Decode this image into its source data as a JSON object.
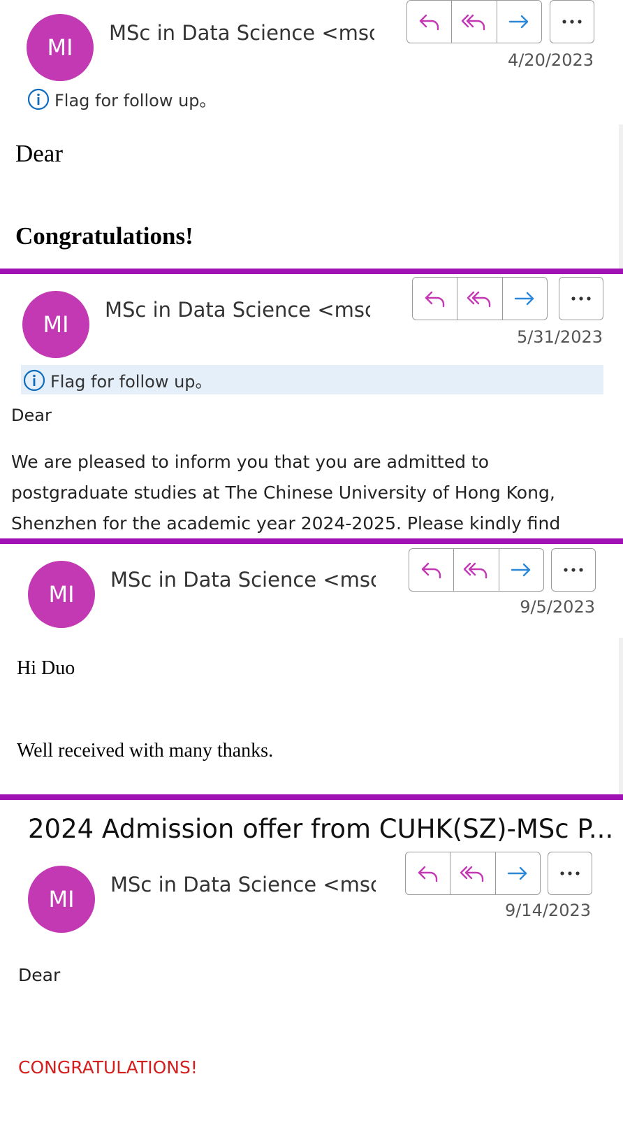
{
  "colors": {
    "accent": "#a012b4",
    "avatar": "#c239b3",
    "reply_icon": "#c239b3",
    "forward_icon": "#2b88d8",
    "flag_icon": "#0f6cbd",
    "alert_red": "#d41f1f"
  },
  "emails": [
    {
      "avatar_initials": "MI",
      "sender": "MSc in Data Science <msc",
      "date": "4/20/2023",
      "flag_text": "Flag for follow up。",
      "body": [
        "Dear",
        "Congratulations!"
      ]
    },
    {
      "avatar_initials": "MI",
      "sender": "MSc in Data Science <msc",
      "date": "5/31/2023",
      "flag_text": "Flag for follow up。",
      "body": [
        "Dear",
        "We are pleased to inform you that you are admitted to",
        "postgraduate studies at The Chinese University of Hong Kong,",
        "Shenzhen for the academic year 2024-2025. Please kindly find"
      ]
    },
    {
      "avatar_initials": "MI",
      "sender": "MSc in Data Science <msc",
      "date": "9/5/2023",
      "body": [
        "Hi Duo",
        "Well received with many thanks."
      ]
    },
    {
      "subject": "2024 Admission offer from CUHK(SZ)-MSc P...",
      "avatar_initials": "MI",
      "sender": "MSc in Data Science <msc",
      "date": "9/14/2023",
      "body": [
        "Dear",
        "CONGRATULATIONS!"
      ]
    }
  ],
  "icons": {
    "reply": "reply-icon",
    "reply_all": "reply-all-icon",
    "forward": "forward-icon",
    "more": "more-icon",
    "info": "info-icon"
  }
}
